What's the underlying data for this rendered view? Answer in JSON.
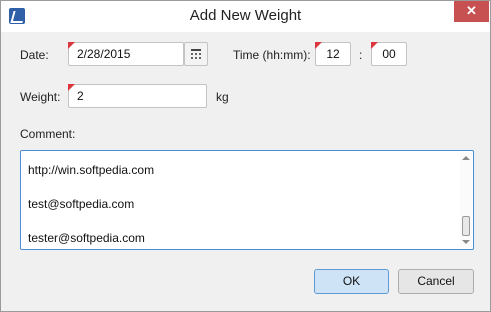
{
  "window": {
    "title": "Add New Weight",
    "close_glyph": "✕"
  },
  "date": {
    "label": "Date:",
    "value": "2/28/2015"
  },
  "time": {
    "label": "Time (hh:mm):",
    "hour": "12",
    "separator": ":",
    "minute": "00"
  },
  "weight": {
    "label": "Weight:",
    "value": "2",
    "unit": "kg"
  },
  "comment": {
    "label": "Comment:",
    "lines": [
      "http://win.softpedia.com",
      "test@softpedia.com",
      "tester@softpedia.com"
    ]
  },
  "buttons": {
    "ok": "OK",
    "cancel": "Cancel"
  },
  "icons": {
    "app": "app-icon",
    "calendar": "calendar-icon"
  },
  "colors": {
    "close_bg": "#c75050",
    "required_marker": "#d9363e",
    "focus_border": "#4a8fd6",
    "ok_bg": "#cfe3f7"
  }
}
